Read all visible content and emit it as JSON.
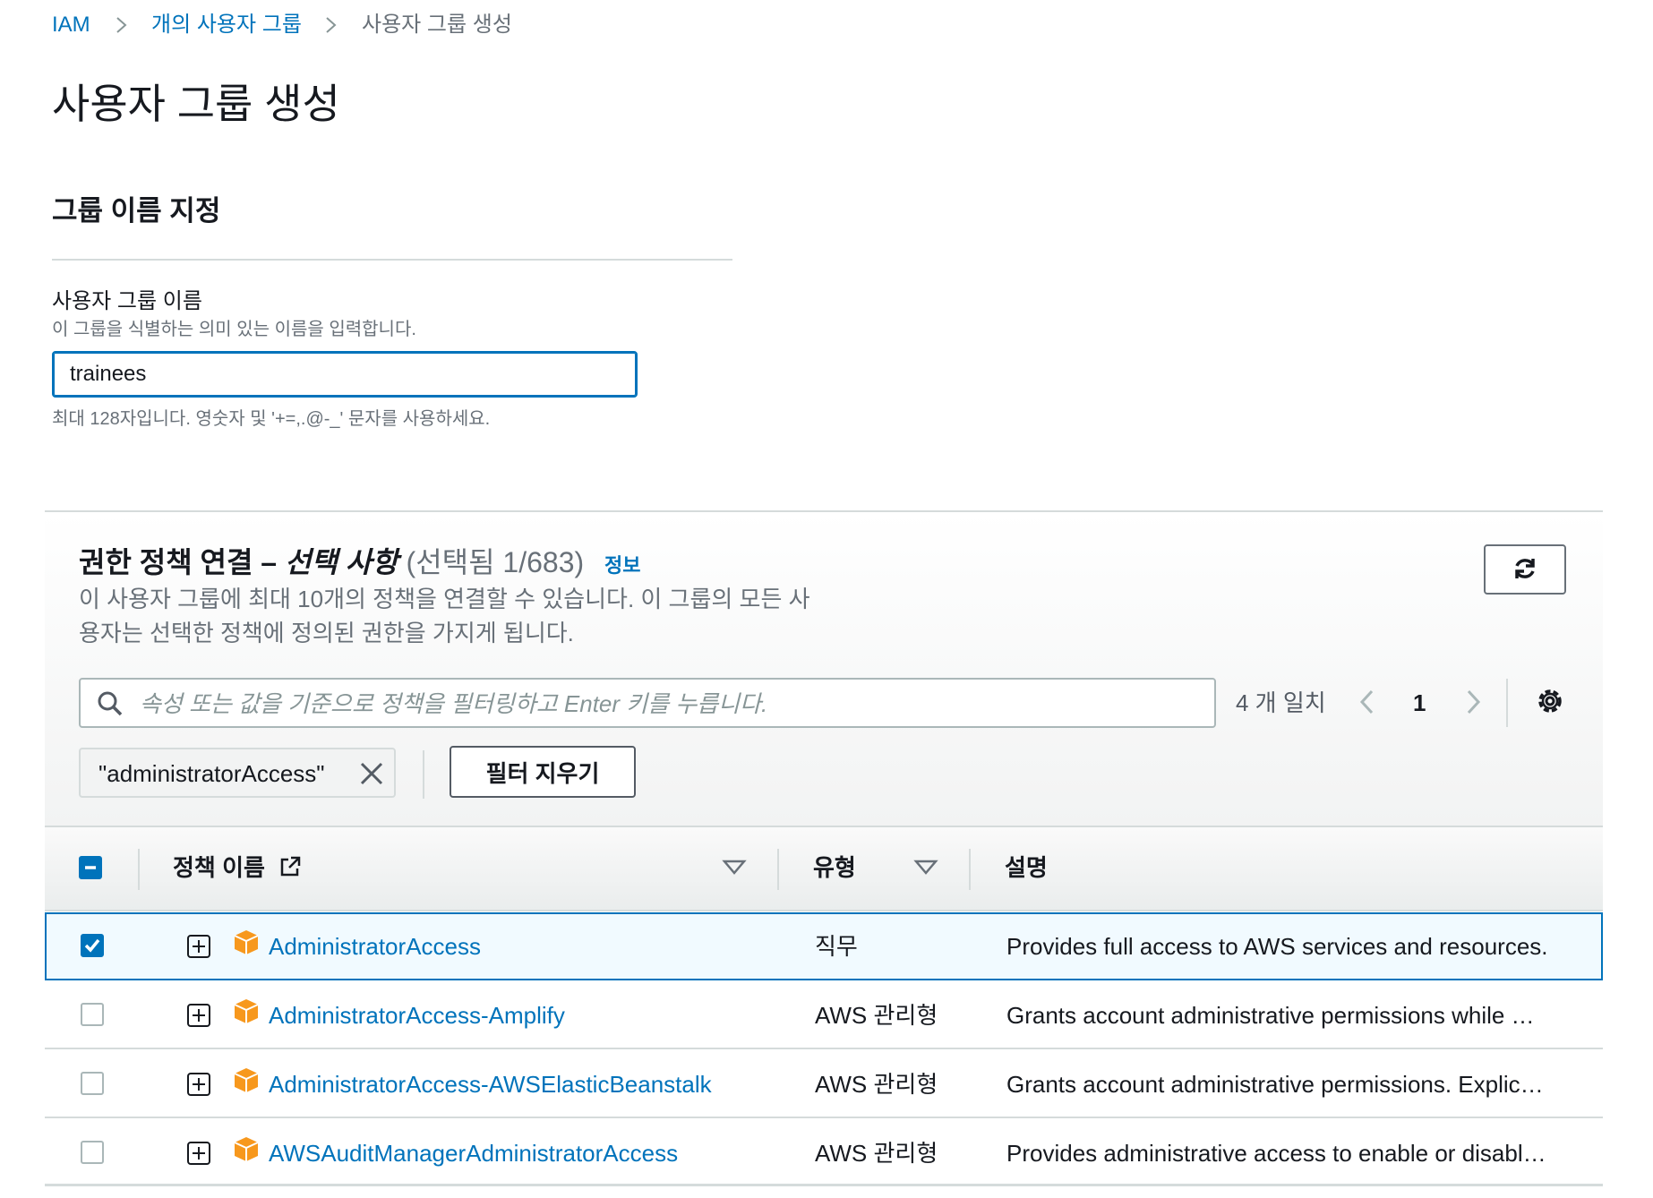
{
  "breadcrumb": {
    "items": [
      "IAM",
      "개의 사용자 그룹",
      "사용자 그룹 생성"
    ],
    "separator": ">"
  },
  "page": {
    "title": "사용자 그룹 생성"
  },
  "group_name_section": {
    "title": "그룹 이름 지정",
    "field_label": "사용자 그룹 이름",
    "field_description": "이 그룹을 식별하는 의미 있는 이름을 입력합니다.",
    "value": "trainees",
    "constraint": "최대 128자입니다. 영숫자 및 '+=,.@-_' 문자를 사용하세요."
  },
  "policies": {
    "title_main": "권한 정책 연결 – ",
    "title_optional": "선택 사항",
    "title_count": " (선택됨 1/683)",
    "info_link": "정보",
    "description": "이 사용자 그룹에 최대 10개의 정책을 연결할 수 있습니다. 이 그룹의 모든 사용자는 선택한 정책에 정의된 권한을 가지게 됩니다.",
    "search_placeholder": "속성 또는 값을 기준으로 정책을 필터링하고 Enter 키를 누릅니다.",
    "match_count": "4 개 일치",
    "current_page": "1",
    "filter_token": "\"administratorAccess\"",
    "clear_filters": "필터 지우기",
    "columns": {
      "name": "정책 이름",
      "type": "유형",
      "description": "설명"
    },
    "rows": [
      {
        "name": "AdministratorAccess",
        "type": "직무",
        "description": "Provides full access to AWS services and resources.",
        "checked": true
      },
      {
        "name": "AdministratorAccess-Amplify",
        "type": "AWS 관리형",
        "description": "Grants account administrative permissions while …",
        "checked": false
      },
      {
        "name": "AdministratorAccess-AWSElasticBeanstalk",
        "type": "AWS 관리형",
        "description": "Grants account administrative permissions. Explic…",
        "checked": false
      },
      {
        "name": "AWSAuditManagerAdministratorAccess",
        "type": "AWS 관리형",
        "description": "Provides administrative access to enable or disabl…",
        "checked": false
      }
    ]
  },
  "colors": {
    "link": "#0073bb",
    "policy_icon": "#f7981d",
    "border": "#d5dbdb"
  },
  "icons": [
    "chevron-right-icon",
    "refresh-icon",
    "search-icon",
    "chevron-left-icon",
    "gear-icon",
    "close-icon",
    "external-link-icon",
    "sort-caret-icon",
    "expand-plus-icon",
    "policy-box-icon"
  ]
}
